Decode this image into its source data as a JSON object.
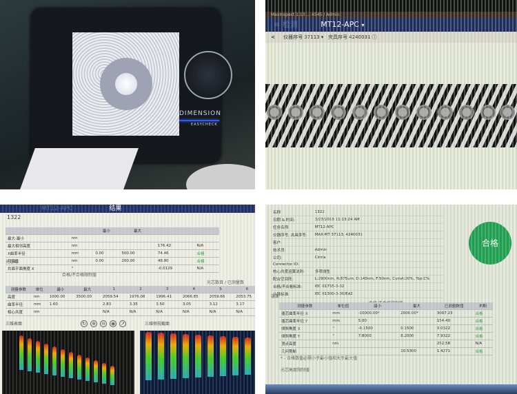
{
  "photo1": {
    "brand": "DIMENSION",
    "subbrand": "EASYCHECK"
  },
  "photo2": {
    "window_title": "MaxInspect 1.13 ... 4545 / Admin",
    "nav": {
      "menu": "检测",
      "product": "MT12-APC",
      "dropdown_icon": "▾"
    },
    "sub": {
      "back": "<",
      "instrument_label": "仪器序号",
      "instrument_value": "37113",
      "fixture_label": "夹具序号",
      "fixture_value": "4240031",
      "info_icon": "ⓘ"
    }
  },
  "photo3": {
    "header": {
      "product": "MT12-APC",
      "title": "结果"
    },
    "serial": "1322",
    "summary_headers": [
      "",
      "",
      "最小",
      "最大",
      "",
      ""
    ],
    "summary_rows": [
      [
        "最大-最小",
        "nm",
        "",
        "",
        "",
        ""
      ],
      [
        "最大相邻高度",
        "nm",
        "",
        "",
        "176.42",
        "N/A"
      ],
      [
        "X曲率半径",
        "mm",
        "0.00",
        "500.00",
        "74.46",
        "合格"
      ],
      [
        "共面性",
        "nm",
        "0.00",
        "200.00",
        "48.80",
        "合格"
      ],
      [
        "共面平面角度 X",
        "°",
        "",
        "",
        "-0.0129",
        "N/A"
      ]
    ],
    "section": "光芯端",
    "fiber_table_title": "光芯数目 / 已测量数",
    "fiber_headers": [
      "测量参数",
      "单位",
      "最小",
      "最大",
      "1",
      "2",
      "3",
      "4",
      "5",
      "6"
    ],
    "limit_label": "合格/不合格限制值",
    "fiber_rows": [
      [
        "高度",
        "nm",
        "1000.00",
        "3500.00",
        "2059.54",
        "1976.08",
        "1996.41",
        "2066.85",
        "2059.66",
        "2053.75"
      ],
      [
        "曲率半径",
        "mm",
        "1.60",
        "",
        "2.83",
        "3.35",
        "3.50",
        "3.05",
        "3.12",
        "3.17"
      ],
      [
        "相心共度",
        "nm",
        "",
        "",
        "N/A",
        "N/A",
        "N/A",
        "N/A",
        "N/A",
        "N/A"
      ]
    ],
    "plot_left_title": "三维表面",
    "plot_right_title": "三维侧视截面",
    "tools": [
      "↻",
      "⊕",
      "⊖",
      "◉",
      "↗"
    ]
  },
  "photo4": {
    "info_rows": [
      [
        "名称",
        "1322"
      ],
      [
        "日期 & 时间:",
        "3/23/2019 11:13:24 AM"
      ],
      [
        "任务名称:",
        "MT12-APC"
      ],
      [
        "仪器序号, 夹具序号:",
        "MAX-MT 37113, 4240031"
      ],
      [
        "客户:",
        ""
      ],
      [
        "技术员:",
        "Admin"
      ],
      [
        "公司:",
        "Cimla"
      ],
      [
        "Connector ID:",
        ""
      ],
      [
        "核心共度运算法则:",
        "多项线性"
      ],
      [
        "配合空间阵:",
        "L:2900nm, R:875um, D:140nm, F:50nm, CumA:20%, Top:C%"
      ],
      [
        "合格/不合格标准:",
        "IEC 61755-3-32"
      ],
      [
        "计算标准:",
        "IEC 61300-3-30/Ed2"
      ]
    ],
    "result_badge": "合格",
    "section": "端面",
    "table_headers": [
      "测量参数",
      "单位值",
      "最小",
      "最大",
      "已测量数值",
      "判断"
    ],
    "limit_label": "合格/不合格限制值",
    "table_rows": [
      [
        "插芯曲率半径 X",
        "mm",
        "-10000.00*",
        "2000.00*",
        "3097.23",
        "合格"
      ],
      [
        "插芯曲率半径 Y",
        "mm",
        "5.00",
        "",
        "154.40",
        "合格"
      ],
      [
        "倾斜角度 X",
        "°",
        "-0.1500",
        "0.1500",
        "0.0322",
        "合格"
      ],
      [
        "倾斜角度 Y",
        "°",
        "7.8000",
        "8.2000",
        "7.9322",
        "合格"
      ],
      [
        "顶点高度",
        "nm",
        "",
        "",
        "252.58",
        "N/A"
      ],
      [
        "几何限制",
        "",
        "",
        "10.5300",
        "1.4271",
        "合格"
      ]
    ],
    "note": "* - 合格数值必需小于最小值和大于最大值",
    "section2": "光芯高度限制值"
  }
}
